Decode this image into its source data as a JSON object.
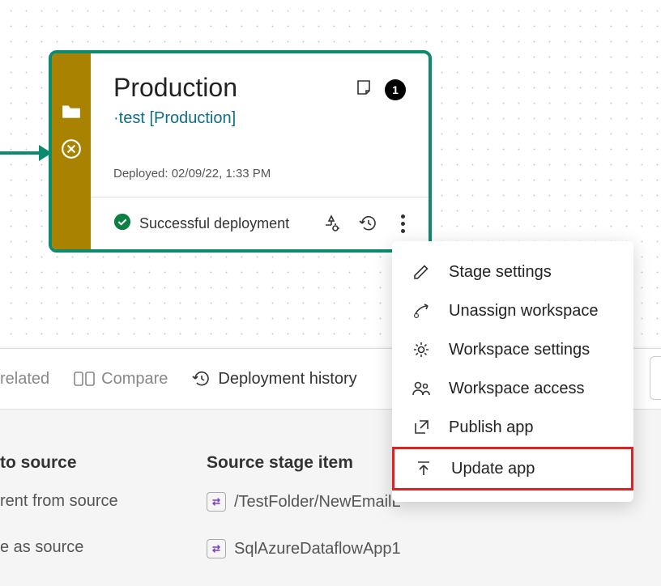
{
  "stage": {
    "title": "Production",
    "subtitle": "·test [Production]",
    "deployed_label": "Deployed:",
    "deployed_time": "02/09/22, 1:33 PM",
    "status": "Successful deployment",
    "badge_count": "1"
  },
  "toolbar": {
    "related": "related",
    "compare": "Compare",
    "history": "Deployment history"
  },
  "table": {
    "col_source_header": "to source",
    "col_stage_header": "Source stage item",
    "row1_source": "rent from source",
    "row1_stage": "/TestFolder/NewEmailL",
    "row2_source": "e as source",
    "row2_stage": "SqlAzureDataflowApp1"
  },
  "menu": {
    "stage_settings": "Stage settings",
    "unassign_workspace": "Unassign workspace",
    "workspace_settings": "Workspace settings",
    "workspace_access": "Workspace access",
    "publish_app": "Publish app",
    "update_app": "Update app"
  }
}
